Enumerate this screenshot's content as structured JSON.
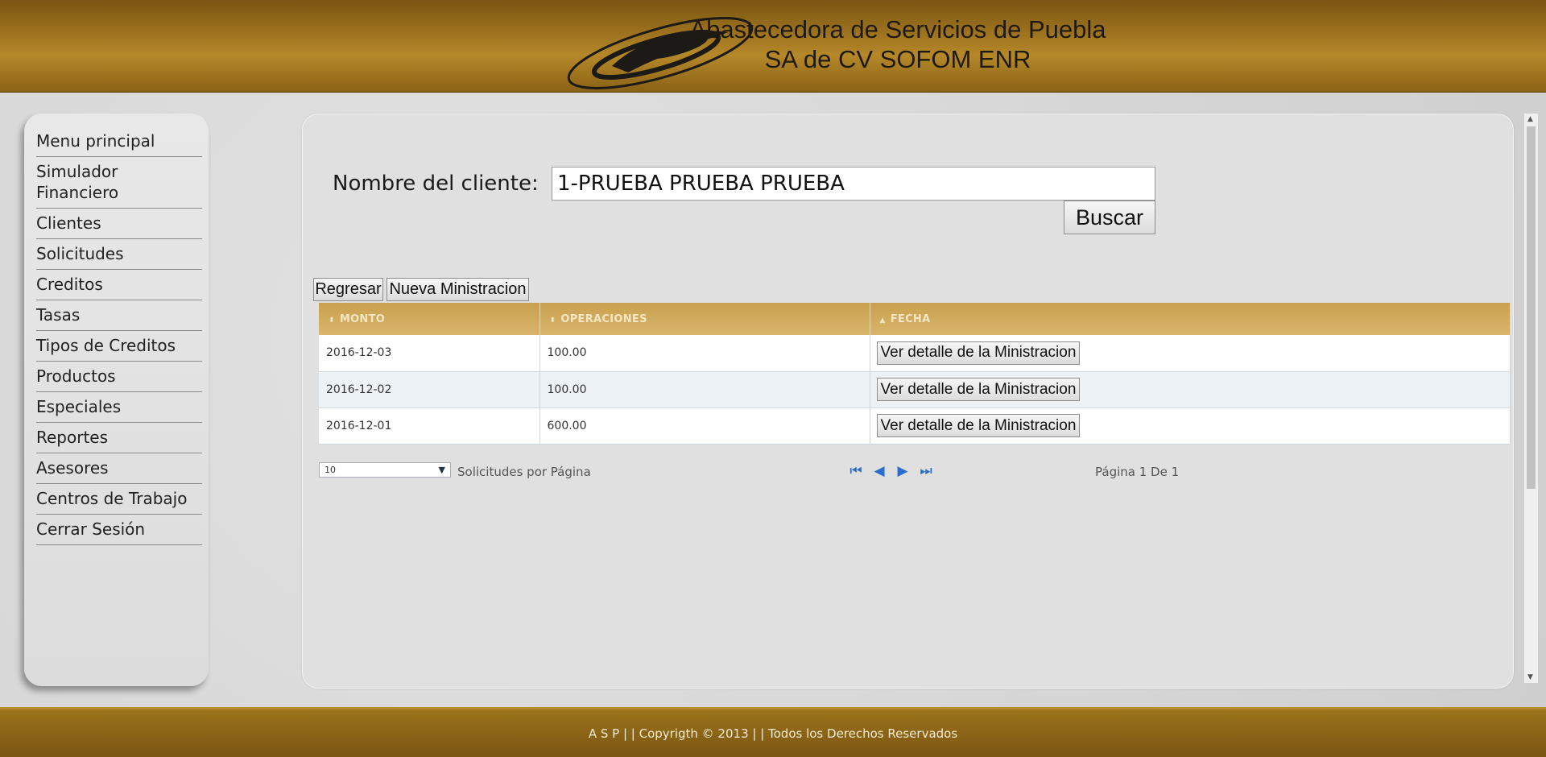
{
  "header": {
    "title_line1": "Abastecedora de Servicios de Puebla",
    "title_line2": "SA de CV SOFOM ENR",
    "logo_icon": "swoosh-logo"
  },
  "sidebar": {
    "items": [
      {
        "label": "Menu principal"
      },
      {
        "label": "Simulador Financiero"
      },
      {
        "label": "Clientes"
      },
      {
        "label": "Solicitudes"
      },
      {
        "label": "Creditos"
      },
      {
        "label": "Tasas"
      },
      {
        "label": "Tipos de Creditos"
      },
      {
        "label": "Productos"
      },
      {
        "label": "Especiales"
      },
      {
        "label": "Reportes"
      },
      {
        "label": "Asesores"
      },
      {
        "label": "Centros de Trabajo"
      },
      {
        "label": "Cerrar Sesión"
      }
    ]
  },
  "search": {
    "label": "Nombre del cliente:",
    "value": "1-PRUEBA PRUEBA PRUEBA",
    "button": "Buscar"
  },
  "actions": {
    "back": "Regresar",
    "new": "Nueva Ministracion"
  },
  "table": {
    "columns": [
      "MONTO",
      "OPERACIONES",
      "FECHA"
    ],
    "rows": [
      {
        "monto": "2016-12-03",
        "operaciones": "100.00",
        "action": "Ver detalle de la Ministracion"
      },
      {
        "monto": "2016-12-02",
        "operaciones": "100.00",
        "action": "Ver detalle de la Ministracion"
      },
      {
        "monto": "2016-12-01",
        "operaciones": "600.00",
        "action": "Ver detalle de la Ministracion"
      }
    ]
  },
  "pager": {
    "page_size": "10",
    "page_size_label": "Solicitudes por Página",
    "info": "Página 1 De 1",
    "icons": [
      "first-page-icon",
      "prev-page-icon",
      "next-page-icon",
      "last-page-icon"
    ]
  },
  "footer": {
    "text": "A S P  | |  Copyrigth © 2013  | |  Todos los Derechos Reservados"
  },
  "colors": {
    "header_gold": "#a67a22",
    "table_header": "#d0aa5c",
    "pager_blue": "#2a6fd0"
  }
}
